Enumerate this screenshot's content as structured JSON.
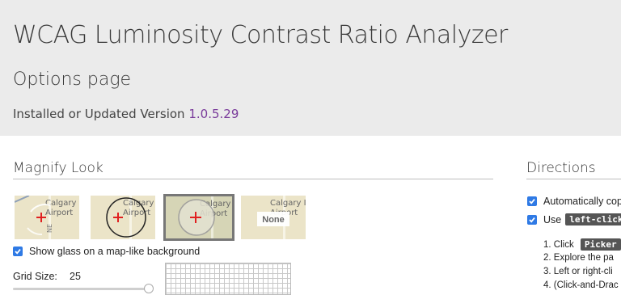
{
  "header": {
    "title": "WCAG Luminosity Contrast Ratio Analyzer",
    "subtitle": "Options page",
    "version_prefix": "Installed or Updated Version",
    "version": "1.0.5.29"
  },
  "colors": {
    "header_bg": "#ebebeb",
    "version_accent": "#7a3c9b",
    "checkbox_blue": "#2f7ae5",
    "airplane_red": "#e02020"
  },
  "magnify": {
    "section_title": "Magnify Look",
    "map_labels": {
      "line1": "Calgary I",
      "line2": "Airport",
      "street": "NE"
    },
    "none_label": "None",
    "selected_index": 2,
    "show_glass_label": "Show glass on a map-like background",
    "grid_label": "Grid Size:",
    "grid_value": "25"
  },
  "directions": {
    "section_title": "Directions",
    "auto_copy_label": "Automatically cop",
    "use_label": "Use",
    "use_code": "left-click",
    "steps": [
      {
        "text": "1. Click",
        "code": "Picker"
      },
      {
        "text": "2. Explore the pa",
        "code": ""
      },
      {
        "text": "3. Left or right-cli",
        "code": ""
      },
      {
        "text": "4. (Click-and-Drac",
        "code": ""
      }
    ]
  }
}
